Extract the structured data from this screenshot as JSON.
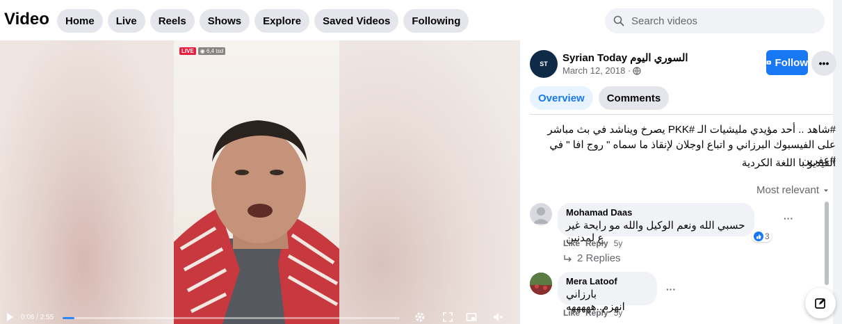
{
  "app": {
    "title": "Video"
  },
  "nav": {
    "items": [
      {
        "label": "Home"
      },
      {
        "label": "Live"
      },
      {
        "label": "Reels"
      },
      {
        "label": "Shows"
      },
      {
        "label": "Explore"
      },
      {
        "label": "Saved Videos"
      },
      {
        "label": "Following"
      }
    ]
  },
  "search": {
    "placeholder": "Search videos",
    "icon": "search-icon"
  },
  "video": {
    "live_label": "LIVE",
    "viewers": "6,4 tsd",
    "timecode": "0:06 / 2:55",
    "progress_fraction": 0.036,
    "accent_color": "#2d88ff"
  },
  "post": {
    "page_name": "Syrian Today السوري اليوم",
    "avatar_text": "ST",
    "date": "March 12, 2018 ·",
    "follow_label": "Follow",
    "more_label": "•••",
    "tabs": [
      {
        "label": "Overview",
        "active": true
      },
      {
        "label": "Comments",
        "active": false
      }
    ],
    "description_line1": "#شاهد .. أحد مؤيدي مليشيات الـ #PKK يصرخ ويناشد في بث مباشر على الفيسبوك البرزاني و اتباع اوجلان لإنقاذ ما سماه \" روج افا \" في #عفرين",
    "description_line2": "الفيديو با اللغة الكردية",
    "sort_label": "Most relevant",
    "brand_color": "#1877f2"
  },
  "comments": [
    {
      "author": "Mohamad Daas",
      "text": "حسبي الله ونعم الوكيل والله مو رايحة غير ع لمدنين",
      "like": "Like",
      "reply": "Reply",
      "age": "5y",
      "reactions": "3",
      "replies_label": "2 Replies"
    },
    {
      "author": "Mera Latoof",
      "text": "بارزاني انهزم..هههههه",
      "like": "Like",
      "reply": "Reply",
      "age": "5y"
    }
  ]
}
